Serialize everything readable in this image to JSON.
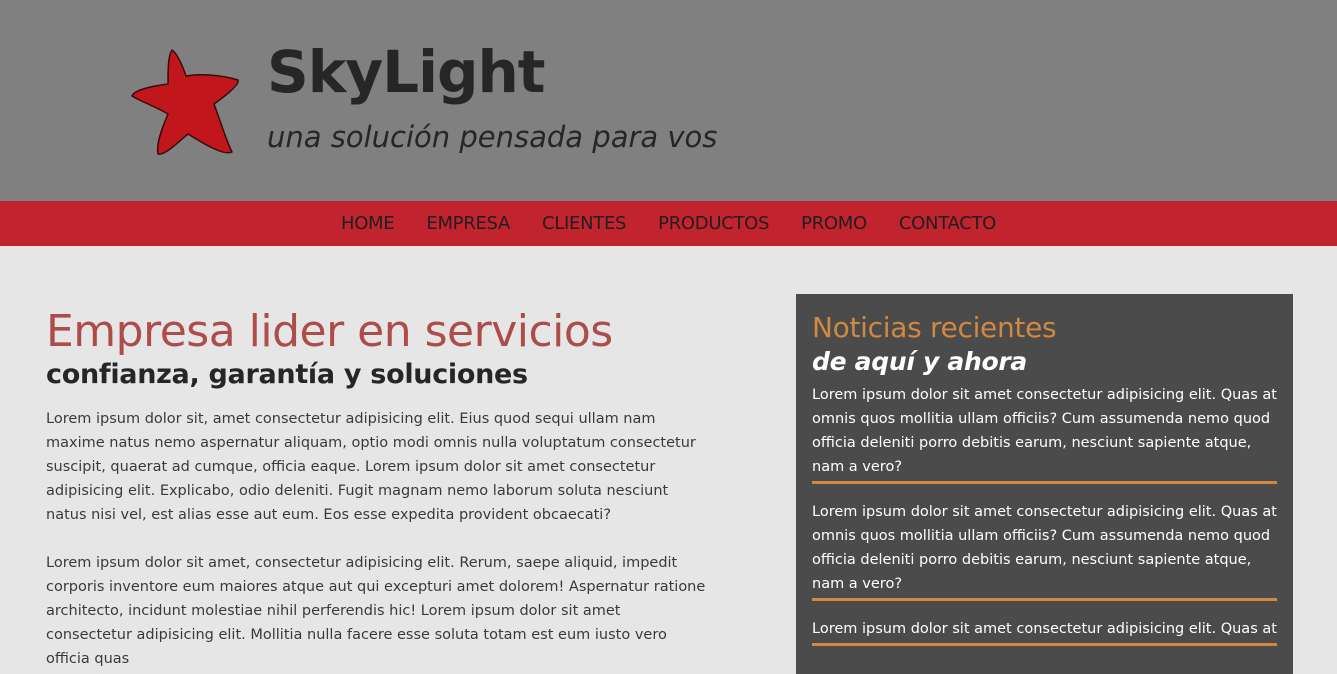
{
  "header": {
    "title": "SkyLight",
    "tagline": "una solución pensada para vos",
    "logo_icon": "star-icon",
    "logo_color": "#c0161c"
  },
  "nav": {
    "items": [
      {
        "label": "HOME"
      },
      {
        "label": "EMPRESA"
      },
      {
        "label": "CLIENTES"
      },
      {
        "label": "PRODUCTOS"
      },
      {
        "label": "PROMO"
      },
      {
        "label": "CONTACTO"
      }
    ]
  },
  "main": {
    "heading": "Empresa lider en servicios",
    "subheading": "confianza, garantía y soluciones",
    "paragraphs": [
      "Lorem ipsum dolor sit, amet consectetur adipisicing elit. Eius quod sequi ullam nam maxime natus nemo aspernatur aliquam, optio modi omnis nulla voluptatum consectetur suscipit, quaerat ad cumque, officia eaque. Lorem ipsum dolor sit amet consectetur adipisicing elit. Explicabo, odio deleniti. Fugit magnam nemo laborum soluta nesciunt natus nisi vel, est alias esse aut eum. Eos esse expedita provident obcaecati?",
      "Lorem ipsum dolor sit amet, consectetur adipisicing elit. Rerum, saepe aliquid, impedit corporis inventore eum maiores atque aut qui excepturi amet dolorem! Aspernatur ratione architecto, incidunt molestiae nihil perferendis hic! Lorem ipsum dolor sit amet consectetur adipisicing elit. Mollitia nulla facere esse soluta totam est eum iusto vero officia quas"
    ]
  },
  "news": {
    "title": "Noticias recientes",
    "subtitle": "de aquí y ahora",
    "items": [
      "Lorem ipsum dolor sit amet consectetur adipisicing elit. Quas at omnis quos mollitia ullam officiis? Cum assumenda nemo quod officia deleniti porro debitis earum, nesciunt sapiente atque, nam a vero?",
      "Lorem ipsum dolor sit amet consectetur adipisicing elit. Quas at omnis quos mollitia ullam officiis? Cum assumenda nemo quod officia deleniti porro debitis earum, nesciunt sapiente atque, nam a vero?",
      "Lorem ipsum dolor sit amet consectetur adipisicing elit. Quas at"
    ]
  },
  "colors": {
    "header_bg": "#808080",
    "nav_bg": "#c1232f",
    "page_bg": "#e6e6e7",
    "heading_red": "#ad4c4b",
    "news_bg": "#4b4b4b",
    "news_accent": "#d1883f"
  }
}
